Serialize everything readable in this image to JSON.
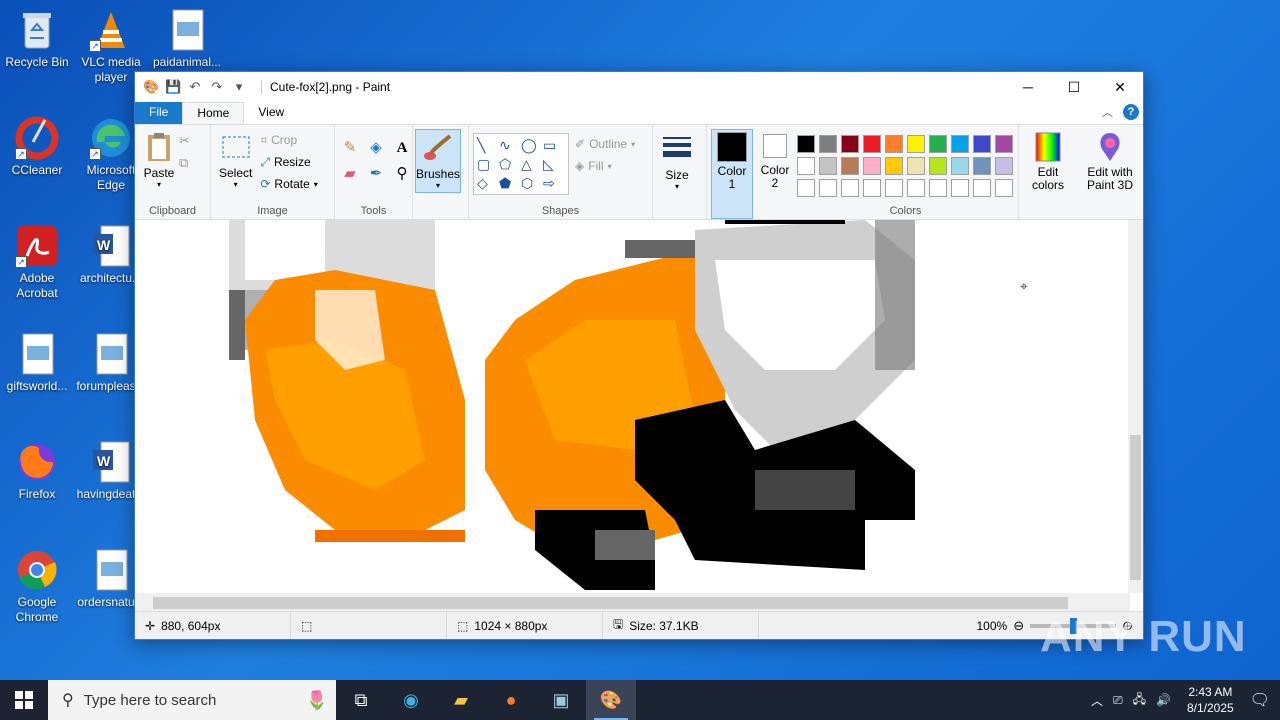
{
  "desktop": {
    "icons": [
      {
        "label": "Recycle Bin",
        "icon": "recycle-bin-icon"
      },
      {
        "label": "VLC media player",
        "icon": "vlc-icon"
      },
      {
        "label": "paidanimal...",
        "icon": "image-file-icon"
      },
      {
        "label": "CCleaner",
        "icon": "ccleaner-icon"
      },
      {
        "label": "Microsoft Edge",
        "icon": "edge-icon"
      },
      {
        "label": "Adobe Acrobat",
        "icon": "acrobat-icon"
      },
      {
        "label": "architectu...",
        "icon": "word-doc-icon"
      },
      {
        "label": "giftsworld...",
        "icon": "image-file-icon"
      },
      {
        "label": "forumpleas...",
        "icon": "image-file-icon"
      },
      {
        "label": "Firefox",
        "icon": "firefox-icon"
      },
      {
        "label": "havingdeat...",
        "icon": "word-doc-icon"
      },
      {
        "label": "Google Chrome",
        "icon": "chrome-icon"
      },
      {
        "label": "ordersnatu...",
        "icon": "image-file-icon"
      }
    ]
  },
  "window": {
    "title": "Cute-fox[2].png - Paint",
    "menu": {
      "file": "File",
      "home": "Home",
      "view": "View"
    },
    "ribbon": {
      "clipboard": {
        "label": "Clipboard",
        "paste": "Paste"
      },
      "image": {
        "label": "Image",
        "select": "Select",
        "crop": "Crop",
        "resize": "Resize",
        "rotate": "Rotate"
      },
      "tools": {
        "label": "Tools"
      },
      "brushes": "Brushes",
      "shapes": {
        "label": "Shapes",
        "outline": "Outline",
        "fill": "Fill"
      },
      "size": "Size",
      "color1": "Color 1",
      "color2": "Color 2",
      "colors": {
        "label": "Colors",
        "edit": "Edit colors"
      },
      "paint3d": "Edit with Paint 3D"
    },
    "palette": [
      "#000000",
      "#7f7f7f",
      "#880015",
      "#ed1c24",
      "#ff7f27",
      "#fff200",
      "#22b14c",
      "#00a2e8",
      "#3f48cc",
      "#a349a4",
      "#ffffff",
      "#c3c3c3",
      "#b97a57",
      "#ffaec9",
      "#ffc90e",
      "#efe4b0",
      "#b5e61d",
      "#99d9ea",
      "#7092be",
      "#c8bfe7",
      "#ffffff",
      "#ffffff",
      "#ffffff",
      "#ffffff",
      "#ffffff",
      "#ffffff",
      "#ffffff",
      "#ffffff",
      "#ffffff",
      "#ffffff"
    ],
    "status": {
      "cursor_pos": "880, 604px",
      "image_size": "1024 × 880px",
      "file_size": "Size: 37.1KB",
      "zoom": "100%"
    }
  },
  "taskbar": {
    "search_placeholder": "Type here to search",
    "time": "2:43 AM",
    "date": "8/1/2025"
  },
  "watermark": "ANY RUN"
}
